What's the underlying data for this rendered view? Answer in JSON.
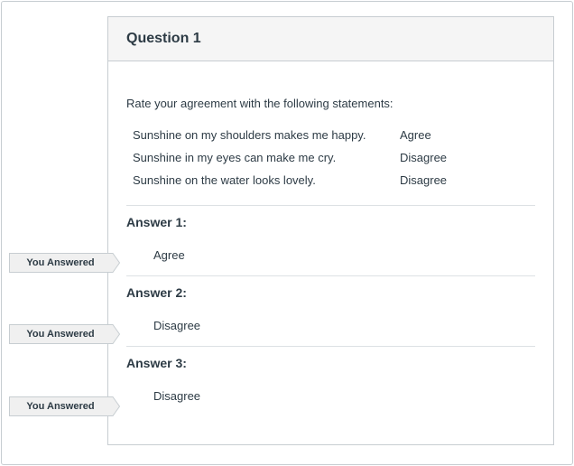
{
  "question": {
    "title": "Question 1",
    "prompt": "Rate your agreement with the following statements:",
    "statements": [
      {
        "text": "Sunshine on my shoulders makes me happy.",
        "value": "Agree"
      },
      {
        "text": "Sunshine in my eyes can make me cry.",
        "value": "Disagree"
      },
      {
        "text": "Sunshine on the water looks lovely.",
        "value": "Disagree"
      }
    ]
  },
  "answers": [
    {
      "title": "Answer 1:",
      "value": "Agree",
      "badge": "You Answered"
    },
    {
      "title": "Answer 2:",
      "value": "Disagree",
      "badge": "You Answered"
    },
    {
      "title": "Answer 3:",
      "value": "Disagree",
      "badge": "You Answered"
    }
  ],
  "colors": {
    "border": "#c7cdd1",
    "header_bg": "#f5f5f5",
    "badge_bg": "#f0f0f0",
    "text": "#2d3b45"
  }
}
